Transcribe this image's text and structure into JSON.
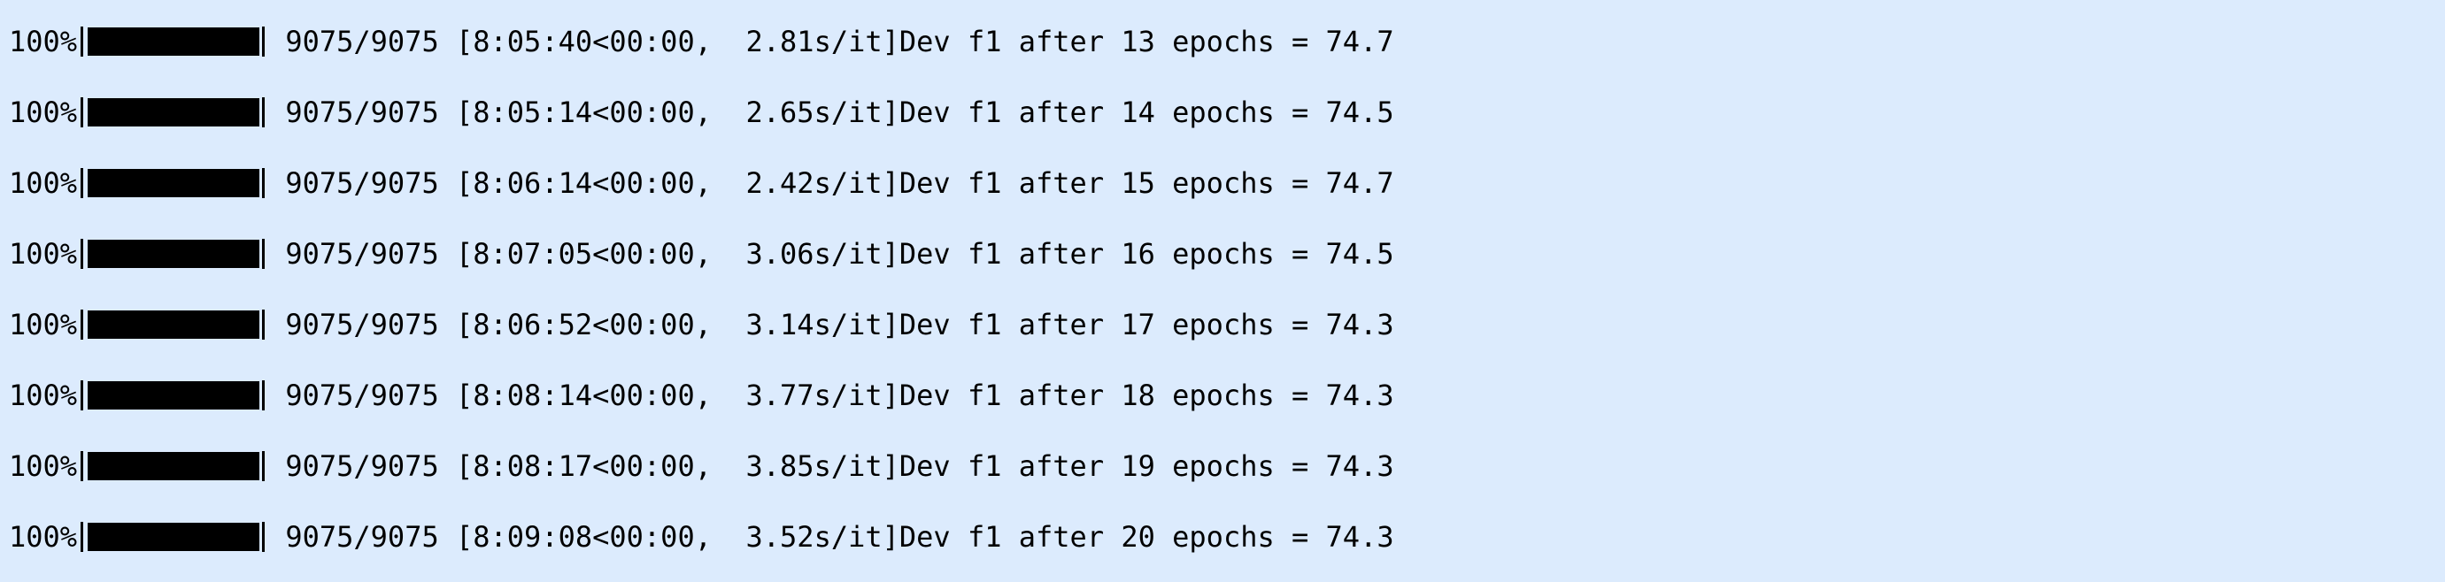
{
  "lines": [
    {
      "percent": "100%",
      "progress": 1.0,
      "stats": " 9075/9075 [8:05:40<00:00,  2.81s/it]Dev f1 after 13 epochs = 74.7"
    },
    {
      "percent": "100%",
      "progress": 1.0,
      "stats": " 9075/9075 [8:05:14<00:00,  2.65s/it]Dev f1 after 14 epochs = 74.5"
    },
    {
      "percent": "100%",
      "progress": 1.0,
      "stats": " 9075/9075 [8:06:14<00:00,  2.42s/it]Dev f1 after 15 epochs = 74.7"
    },
    {
      "percent": "100%",
      "progress": 1.0,
      "stats": " 9075/9075 [8:07:05<00:00,  3.06s/it]Dev f1 after 16 epochs = 74.5"
    },
    {
      "percent": "100%",
      "progress": 1.0,
      "stats": " 9075/9075 [8:06:52<00:00,  3.14s/it]Dev f1 after 17 epochs = 74.3"
    },
    {
      "percent": "100%",
      "progress": 1.0,
      "stats": " 9075/9075 [8:08:14<00:00,  3.77s/it]Dev f1 after 18 epochs = 74.3"
    },
    {
      "percent": "100%",
      "progress": 1.0,
      "stats": " 9075/9075 [8:08:17<00:00,  3.85s/it]Dev f1 after 19 epochs = 74.3"
    },
    {
      "percent": "100%",
      "progress": 1.0,
      "stats": " 9075/9075 [8:09:08<00:00,  3.52s/it]Dev f1 after 20 epochs = 74.3"
    }
  ],
  "colors": {
    "background": "#dcebfd",
    "text": "#000000",
    "bar": "#000000"
  }
}
